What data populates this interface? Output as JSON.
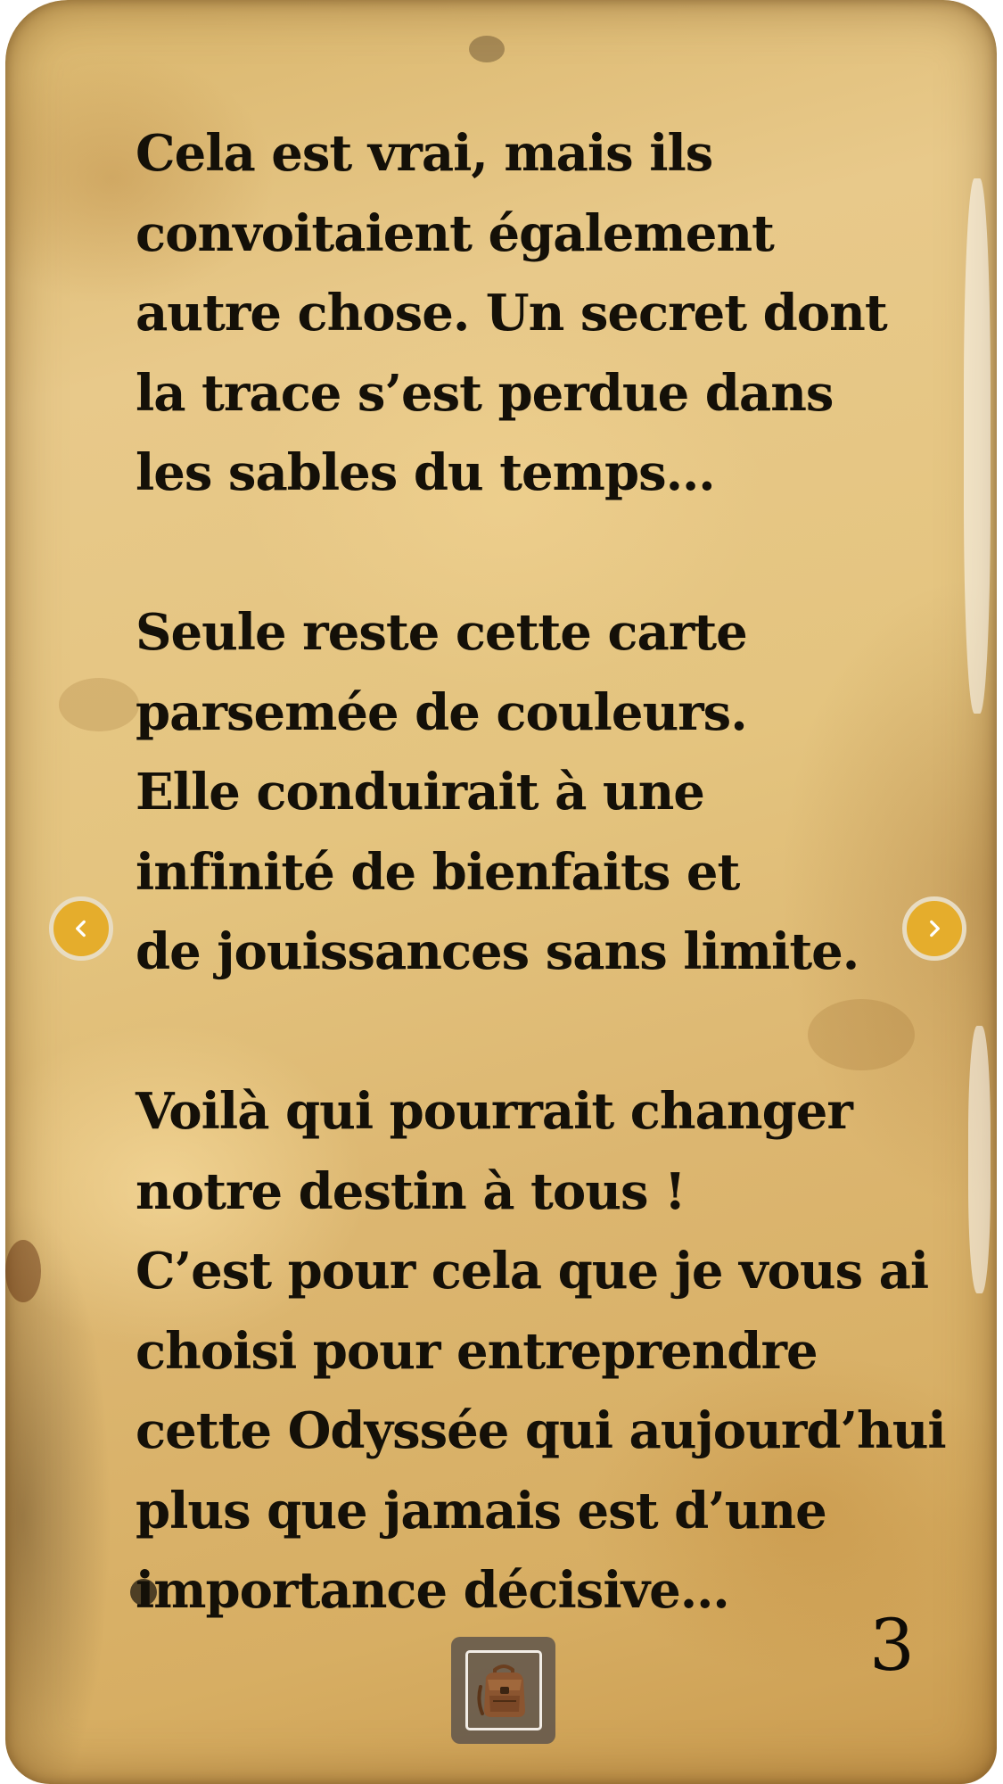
{
  "story": {
    "paragraphs": [
      {
        "lines": [
          "Cela est vrai, mais ils",
          "convoitaient également",
          "autre chose. Un secret dont",
          "la trace s’est perdue dans",
          "les sables du temps…"
        ]
      },
      {
        "lines": [
          "Seule reste cette carte",
          "parsemée de couleurs.",
          "Elle conduirait à une",
          "infinité de bienfaits et",
          "de jouissances sans limite."
        ]
      },
      {
        "lines": [
          "Voilà qui pourrait changer",
          "notre destin à tous !",
          "C’est pour cela que je vous ai",
          "choisi pour entreprendre",
          "cette Odyssée qui aujourd’hui",
          "plus que jamais est d’une",
          "importance décisive…"
        ]
      }
    ],
    "page_number": "3"
  },
  "navigation": {
    "prev_icon": "chevron-left-icon",
    "next_icon": "chevron-right-icon",
    "button_color": "#e5ad2c"
  },
  "inventory": {
    "icon": "backpack-icon"
  },
  "colors": {
    "parchment": "#e4c47f",
    "text": "#141008"
  }
}
